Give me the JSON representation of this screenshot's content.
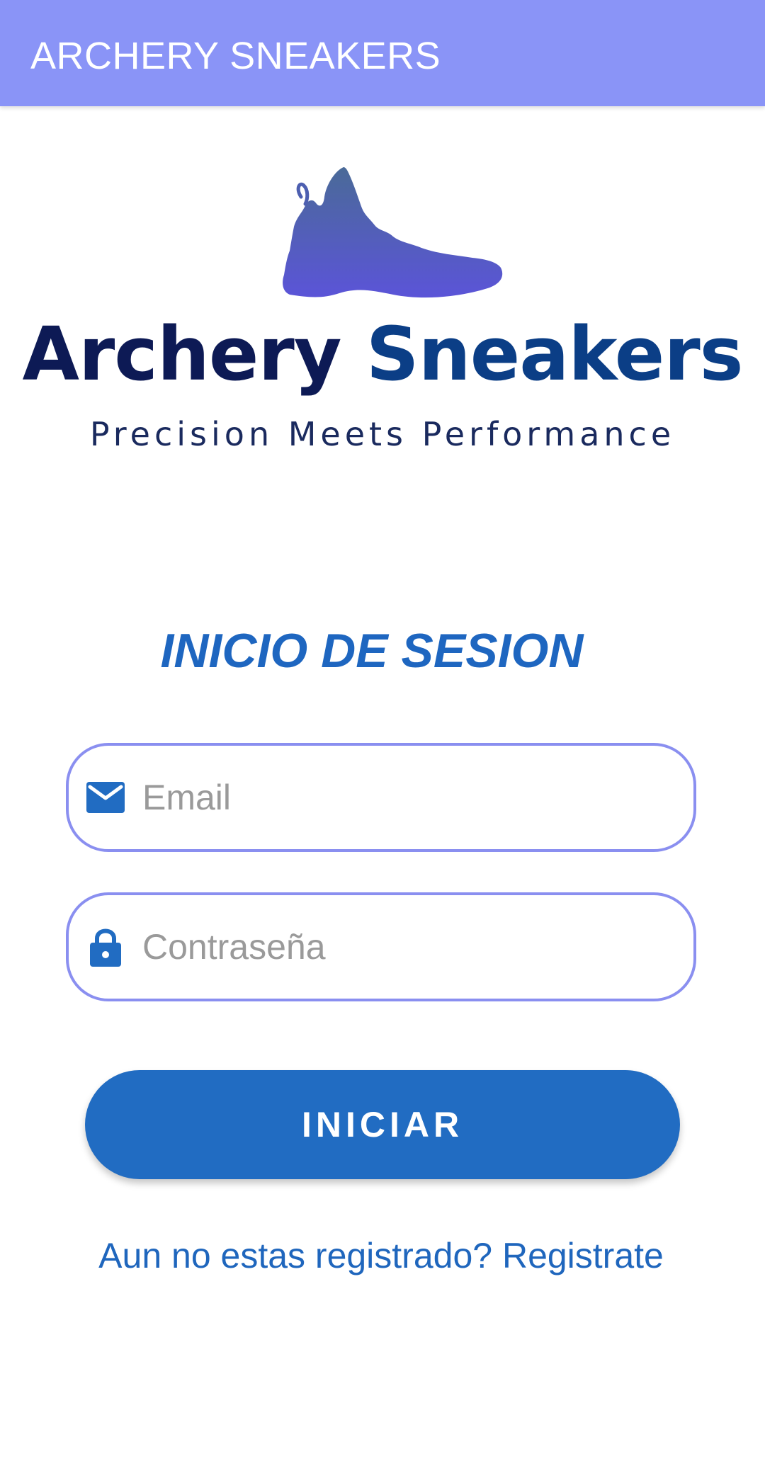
{
  "app_bar": {
    "title": "ARCHERY SNEAKERS",
    "background": "#8a94f7"
  },
  "logo": {
    "icon": "sneaker-icon",
    "brand_word1": "Archery",
    "brand_word2": "Sneakers",
    "tagline": "Precision Meets Performance"
  },
  "login": {
    "title": "INICIO DE SESION",
    "email_field": {
      "icon": "mail-icon",
      "placeholder": "Email",
      "value": ""
    },
    "password_field": {
      "icon": "lock-icon",
      "placeholder": "Contraseña",
      "value": ""
    },
    "submit_label": "INICIAR",
    "register_link": "Aun no estas registrado? Registrate"
  },
  "colors": {
    "accent": "#216cc2",
    "field_border": "#8a8ff0"
  }
}
